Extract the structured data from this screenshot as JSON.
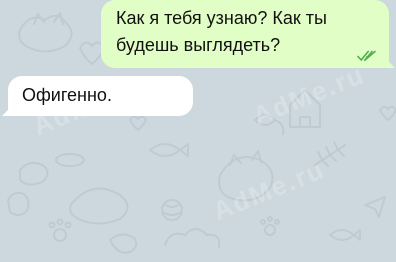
{
  "chat": {
    "messages": [
      {
        "direction": "outgoing",
        "lines": [
          "Как я тебя узнаю? Как ты",
          "будешь выглядеть?"
        ],
        "status": "read",
        "status_icon": "double-check-icon",
        "bubble_color": "#e1fec6",
        "status_color": "#4fae4e"
      },
      {
        "direction": "incoming",
        "lines": [
          "Офигенно."
        ],
        "bubble_color": "#ffffff"
      }
    ]
  },
  "background": {
    "color": "#cdd8de",
    "watermark_text": "AdMe.ru"
  }
}
